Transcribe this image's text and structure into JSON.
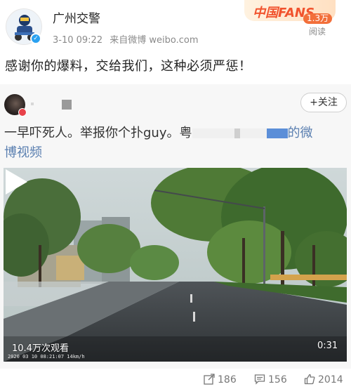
{
  "account": {
    "name": "广州交警",
    "time": "3-10 09:22",
    "source": "来自微博 weibo.com",
    "verified_icon": "verified-badge-icon",
    "fans_badge": "中国FANS",
    "reads_count": "1.3万",
    "reads_label": "阅读"
  },
  "post": {
    "text": "感谢你的爆料，交给我们，这种必须严惩！"
  },
  "repost": {
    "follow_label": "+关注",
    "text_part1": "一早吓死人。举报你个扑guy。粤",
    "text_part2": "的微",
    "text_part3": "博视频",
    "video": {
      "views": "10.4万次观看",
      "duration": "0:31",
      "stamp": "2020 03 10 08:21:07 14km/h",
      "play_icon": "play-icon"
    }
  },
  "actions": {
    "repost_count": "186",
    "comment_count": "156",
    "like_count": "2014",
    "repost_icon": "share-icon",
    "comment_icon": "comment-icon",
    "like_icon": "thumbs-up-icon"
  },
  "colors": {
    "link": "#5a7fb0",
    "fans_accent": "#f1532e",
    "verified": "#2aa1f0"
  }
}
